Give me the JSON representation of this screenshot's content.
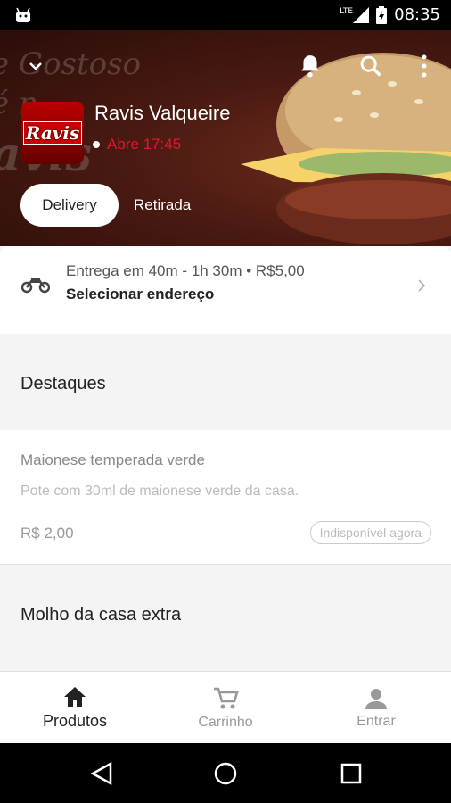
{
  "status_bar": {
    "time": "08:35",
    "network": "LTE"
  },
  "hero": {
    "background_text_line1": "e Gostoso",
    "background_text_line2": "é n",
    "background_text_line3": "avis",
    "logo_text": "Ravis",
    "store_name": "Ravis Valqueire",
    "store_status": "Abre 17:45",
    "tabs": {
      "delivery": "Delivery",
      "pickup": "Retirada"
    }
  },
  "delivery": {
    "info": "Entrega em 40m - 1h 30m • R$5,00",
    "address_action": "Selecionar endereço"
  },
  "sections": [
    {
      "title": "Destaques"
    },
    {
      "title": "Molho da casa extra"
    }
  ],
  "product": {
    "name": "Maionese temperada verde",
    "description": "Pote com 30ml de maionese verde da casa.",
    "price": "R$ 2,00",
    "badge": "Indisponível agora"
  },
  "bottom_nav": {
    "products": "Produtos",
    "cart": "Carrinho",
    "login": "Entrar"
  },
  "colors": {
    "accent": "#e0182d",
    "dark": "#222222"
  }
}
